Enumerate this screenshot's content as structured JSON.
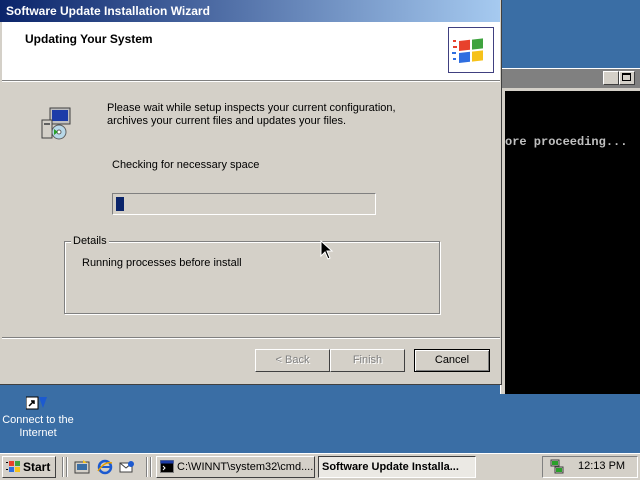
{
  "console": {
    "text": "ore proceeding..."
  },
  "dialog": {
    "title": "Software Update Installation Wizard",
    "header_title": "Updating Your System",
    "message": "Please wait while setup inspects your current configuration, archives your current files and updates your files.",
    "status": "Checking for necessary space",
    "progress_fraction": 0.03,
    "details_label": "Details",
    "details_text": "Running processes before install",
    "buttons": {
      "back": "< Back",
      "finish": "Finish",
      "cancel": "Cancel"
    }
  },
  "desktop": {
    "icon_label": "Connect to the Internet"
  },
  "taskbar": {
    "start_label": "Start",
    "tasks": [
      {
        "label": "C:\\WINNT\\system32\\cmd...."
      },
      {
        "label": "Software Update Installa..."
      }
    ],
    "clock": "12:13 PM"
  },
  "colors": {
    "desktop": "#3a6ea5",
    "title_active": "#0a246a",
    "face": "#d4d0c8"
  }
}
